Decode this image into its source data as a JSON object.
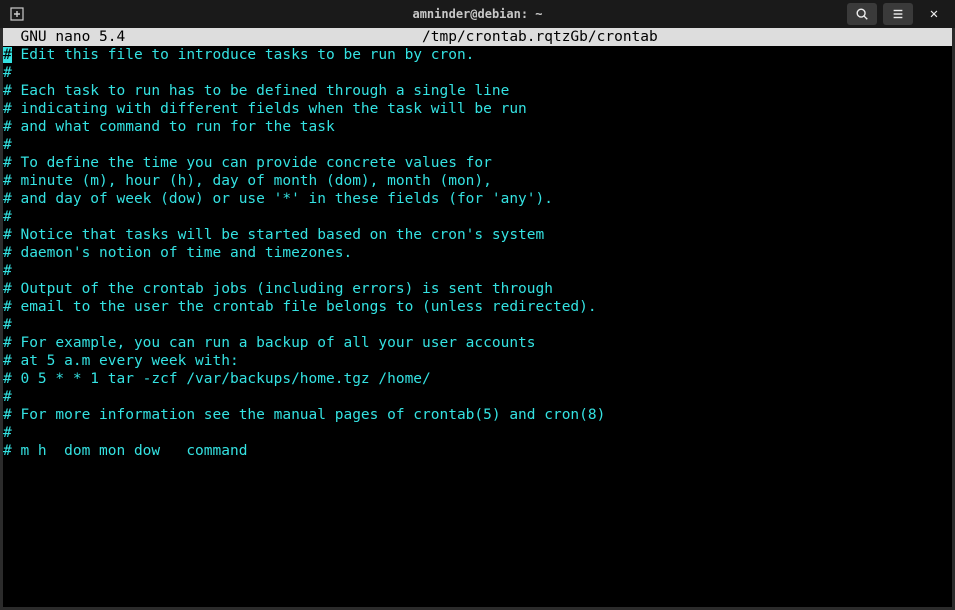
{
  "titlebar": {
    "title": "amninder@debian: ~"
  },
  "editor": {
    "app_name": "  GNU nano 5.4",
    "file_path": "/tmp/crontab.rqtzGb/crontab",
    "header_spaces": "                                  ",
    "header_trail": "                                   ",
    "lines": [
      {
        "cursor": true,
        "text": " Edit this file to introduce tasks to be run by cron."
      },
      {
        "cursor": false,
        "text": "#"
      },
      {
        "cursor": false,
        "text": "# Each task to run has to be defined through a single line"
      },
      {
        "cursor": false,
        "text": "# indicating with different fields when the task will be run"
      },
      {
        "cursor": false,
        "text": "# and what command to run for the task"
      },
      {
        "cursor": false,
        "text": "#"
      },
      {
        "cursor": false,
        "text": "# To define the time you can provide concrete values for"
      },
      {
        "cursor": false,
        "text": "# minute (m), hour (h), day of month (dom), month (mon),"
      },
      {
        "cursor": false,
        "text": "# and day of week (dow) or use '*' in these fields (for 'any')."
      },
      {
        "cursor": false,
        "text": "#"
      },
      {
        "cursor": false,
        "text": "# Notice that tasks will be started based on the cron's system"
      },
      {
        "cursor": false,
        "text": "# daemon's notion of time and timezones."
      },
      {
        "cursor": false,
        "text": "#"
      },
      {
        "cursor": false,
        "text": "# Output of the crontab jobs (including errors) is sent through"
      },
      {
        "cursor": false,
        "text": "# email to the user the crontab file belongs to (unless redirected)."
      },
      {
        "cursor": false,
        "text": "#"
      },
      {
        "cursor": false,
        "text": "# For example, you can run a backup of all your user accounts"
      },
      {
        "cursor": false,
        "text": "# at 5 a.m every week with:"
      },
      {
        "cursor": false,
        "text": "# 0 5 * * 1 tar -zcf /var/backups/home.tgz /home/"
      },
      {
        "cursor": false,
        "text": "#"
      },
      {
        "cursor": false,
        "text": "# For more information see the manual pages of crontab(5) and cron(8)"
      },
      {
        "cursor": false,
        "text": "#"
      },
      {
        "cursor": false,
        "text": "# m h  dom mon dow   command"
      }
    ]
  },
  "colors": {
    "comment": "#34e2e2",
    "header_bg": "#dddddd",
    "terminal_bg": "#000000"
  }
}
